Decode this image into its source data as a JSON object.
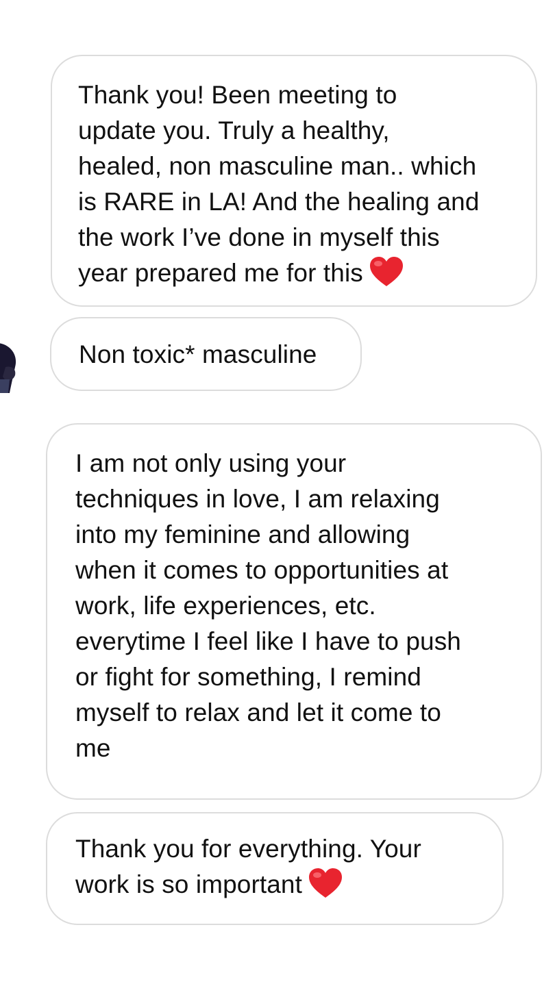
{
  "messages": [
    {
      "text": "Thank you! Been meeting to\nupdate you. Truly a healthy,\nhealed, non masculine man.. which\nis RARE in LA! And the healing and\nthe work I’ve done in myself this\nyear prepared me for this",
      "emoji": "red-heart-icon"
    },
    {
      "text": "Non toxic* masculine"
    },
    {
      "text": "I am not only using your\ntechniques in love, I am relaxing\ninto my feminine and allowing\nwhen it comes to opportunities at\nwork, life experiences, etc.\neverytime I feel like I have to push\nor fight for something, I remind\nmyself to relax and let it come to\nme"
    },
    {
      "text": "Thank you for everything. Your\nwork is so important",
      "emoji": "red-heart-icon"
    }
  ],
  "colors": {
    "bubble_border": "#dcdcdc",
    "text": "#111111",
    "heart": "#e8242f"
  }
}
